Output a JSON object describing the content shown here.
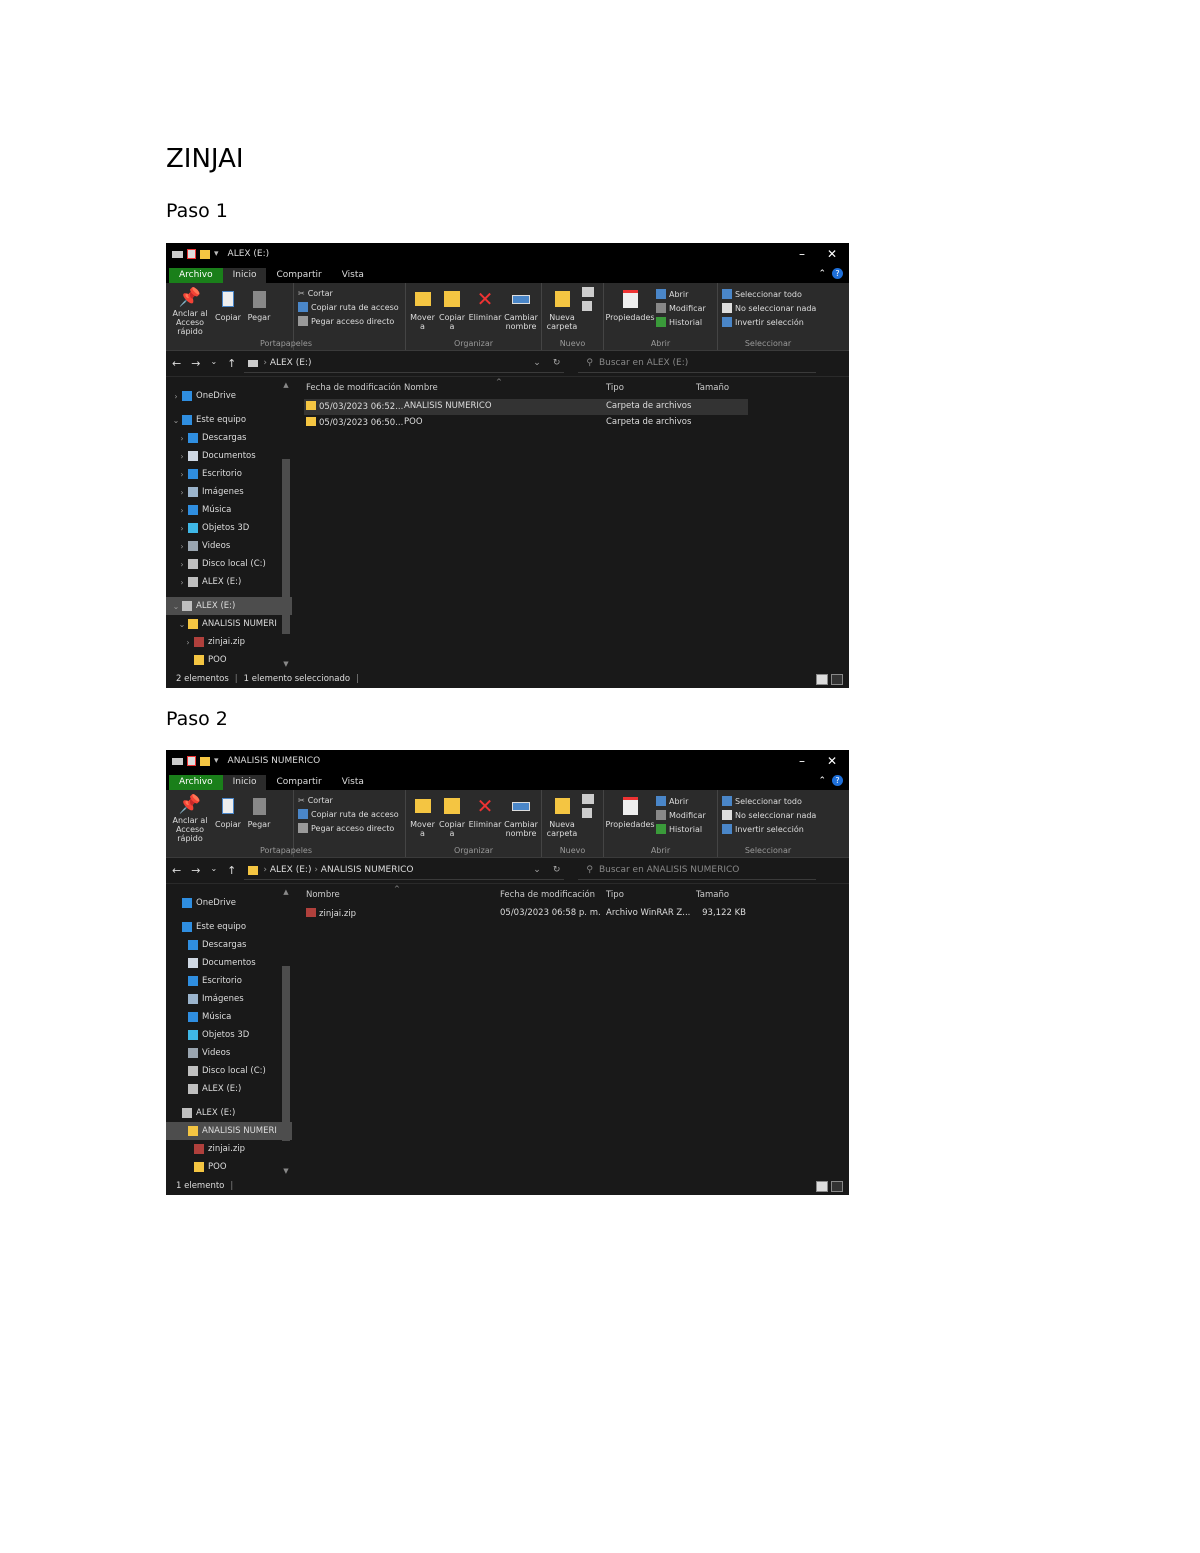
{
  "document": {
    "title": "ZINJAI",
    "steps": [
      {
        "label": "Paso 1"
      },
      {
        "label": "Paso 2"
      }
    ]
  },
  "colors": {
    "file_tab": "#1a7f1a",
    "folder": "#f4c542",
    "window_bg": "#191919",
    "ribbon_bg": "#2b2b2b"
  },
  "windows": [
    {
      "title": "ALEX (E:)",
      "controls": [
        "–",
        "✕"
      ],
      "tabs": {
        "file": "Archivo",
        "home": "Inicio",
        "share": "Compartir",
        "view": "Vista"
      },
      "ribbon": {
        "pin": "Anclar al Acceso rápido",
        "copy": "Copiar",
        "paste": "Pegar",
        "cut": "Cortar",
        "copy_path": "Copiar ruta de acceso",
        "paste_shortcut": "Pegar acceso directo",
        "clipboard": "Portapapeles",
        "move_to": "Mover a",
        "copy_to": "Copiar a",
        "delete": "Eliminar",
        "rename": "Cambiar nombre",
        "organize": "Organizar",
        "new_folder": "Nueva carpeta",
        "new": "Nuevo",
        "properties": "Propiedades",
        "open": "Abrir",
        "edit": "Modificar",
        "history": "Historial",
        "open_group": "Abrir",
        "select_all": "Seleccionar todo",
        "select_none": "No seleccionar nada",
        "invert": "Invertir selección",
        "select": "Seleccionar"
      },
      "address": {
        "crumbs": [
          "ALEX (E:)"
        ]
      },
      "search_placeholder": "Buscar en ALEX (E:)",
      "nav": [
        {
          "label": "OneDrive",
          "icon": "cloud-icon"
        },
        {
          "label": "Este equipo",
          "icon": "computer-icon"
        },
        {
          "label": "Descargas",
          "icon": "download-icon"
        },
        {
          "label": "Documentos",
          "icon": "document-icon"
        },
        {
          "label": "Escritorio",
          "icon": "desktop-icon"
        },
        {
          "label": "Imágenes",
          "icon": "image-icon"
        },
        {
          "label": "Música",
          "icon": "music-icon"
        },
        {
          "label": "Objetos 3D",
          "icon": "cube-icon"
        },
        {
          "label": "Videos",
          "icon": "video-icon"
        },
        {
          "label": "Disco local (C:)",
          "icon": "drive-icon"
        },
        {
          "label": "ALEX (E:)",
          "icon": "drive-icon"
        },
        {
          "label": "ALEX (E:)",
          "icon": "drive-icon"
        },
        {
          "label": "ANALISIS NUMERI",
          "icon": "folder-icon"
        },
        {
          "label": "zinjai.zip",
          "icon": "archive-icon"
        },
        {
          "label": "POO",
          "icon": "folder-icon"
        }
      ],
      "columns": [
        "Fecha de modificación",
        "Nombre",
        "Tipo",
        "Tamaño"
      ],
      "files": [
        {
          "date": "05/03/2023 06:52...",
          "name": "ANALISIS NUMERICO",
          "type": "Carpeta de archivos",
          "size": ""
        },
        {
          "date": "05/03/2023 06:50...",
          "name": "POO",
          "type": "Carpeta de archivos",
          "size": ""
        }
      ],
      "status": {
        "count": "2 elementos",
        "selected": "1 elemento seleccionado"
      }
    },
    {
      "title": "ANALISIS NUMERICO",
      "controls": [
        "–",
        "✕"
      ],
      "tabs": {
        "file": "Archivo",
        "home": "Inicio",
        "share": "Compartir",
        "view": "Vista"
      },
      "ribbon": {
        "pin": "Anclar al Acceso rápido",
        "copy": "Copiar",
        "paste": "Pegar",
        "cut": "Cortar",
        "copy_path": "Copiar ruta de acceso",
        "paste_shortcut": "Pegar acceso directo",
        "clipboard": "Portapapeles",
        "move_to": "Mover a",
        "copy_to": "Copiar a",
        "delete": "Eliminar",
        "rename": "Cambiar nombre",
        "organize": "Organizar",
        "new_folder": "Nueva carpeta",
        "new": "Nuevo",
        "properties": "Propiedades",
        "open": "Abrir",
        "edit": "Modificar",
        "history": "Historial",
        "open_group": "Abrir",
        "select_all": "Seleccionar todo",
        "select_none": "No seleccionar nada",
        "invert": "Invertir selección",
        "select": "Seleccionar"
      },
      "address": {
        "crumbs": [
          "ALEX (E:)",
          "ANALISIS NUMERICO"
        ]
      },
      "search_placeholder": "Buscar en ANALISIS NUMERICO",
      "nav": [
        {
          "label": "OneDrive",
          "icon": "cloud-icon"
        },
        {
          "label": "Este equipo",
          "icon": "computer-icon"
        },
        {
          "label": "Descargas",
          "icon": "download-icon"
        },
        {
          "label": "Documentos",
          "icon": "document-icon"
        },
        {
          "label": "Escritorio",
          "icon": "desktop-icon"
        },
        {
          "label": "Imágenes",
          "icon": "image-icon"
        },
        {
          "label": "Música",
          "icon": "music-icon"
        },
        {
          "label": "Objetos 3D",
          "icon": "cube-icon"
        },
        {
          "label": "Videos",
          "icon": "video-icon"
        },
        {
          "label": "Disco local (C:)",
          "icon": "drive-icon"
        },
        {
          "label": "ALEX (E:)",
          "icon": "drive-icon"
        },
        {
          "label": "ALEX (E:)",
          "icon": "drive-icon"
        },
        {
          "label": "ANALISIS NUMERI",
          "icon": "folder-icon"
        },
        {
          "label": "zinjai.zip",
          "icon": "archive-icon"
        },
        {
          "label": "POO",
          "icon": "folder-icon"
        }
      ],
      "columns": [
        "Nombre",
        "Fecha de modificación",
        "Tipo",
        "Tamaño"
      ],
      "files": [
        {
          "name": "zinjai.zip",
          "date": "05/03/2023 06:58 p. m.",
          "type": "Archivo WinRAR Z...",
          "size": "93,122 KB"
        }
      ],
      "status": {
        "count": "1 elemento",
        "selected": ""
      }
    }
  ]
}
